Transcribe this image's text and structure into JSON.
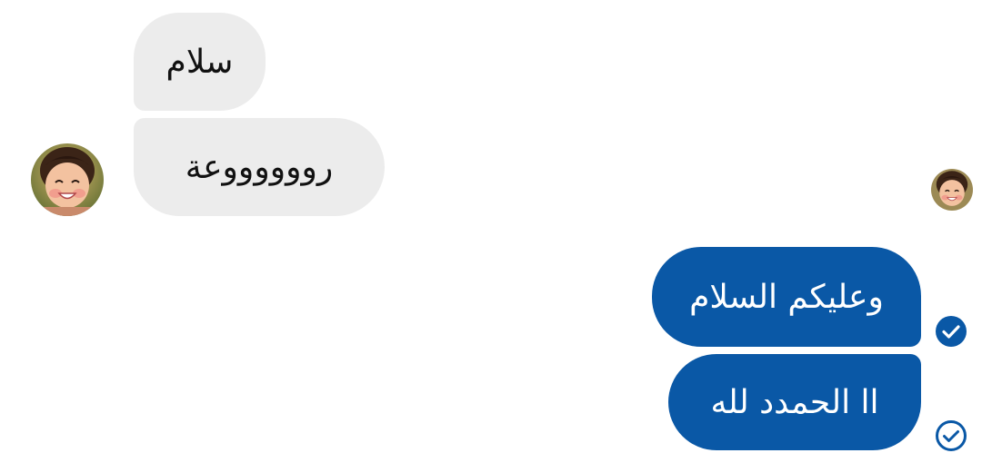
{
  "messages": [
    {
      "direction": "incoming",
      "text": "سلام"
    },
    {
      "direction": "incoming",
      "text": "رووووووعة"
    },
    {
      "direction": "outgoing",
      "text": "وعليكم السلام"
    },
    {
      "direction": "outgoing",
      "text": "اا الحمدد لله"
    }
  ],
  "icons": {
    "avatar": "contact-avatar",
    "read_status": "check-circle-icon"
  },
  "colors": {
    "incoming_bubble": "#ececec",
    "outgoing_bubble": "#0a58a6",
    "outgoing_text": "#ffffff",
    "incoming_text": "#111111"
  }
}
